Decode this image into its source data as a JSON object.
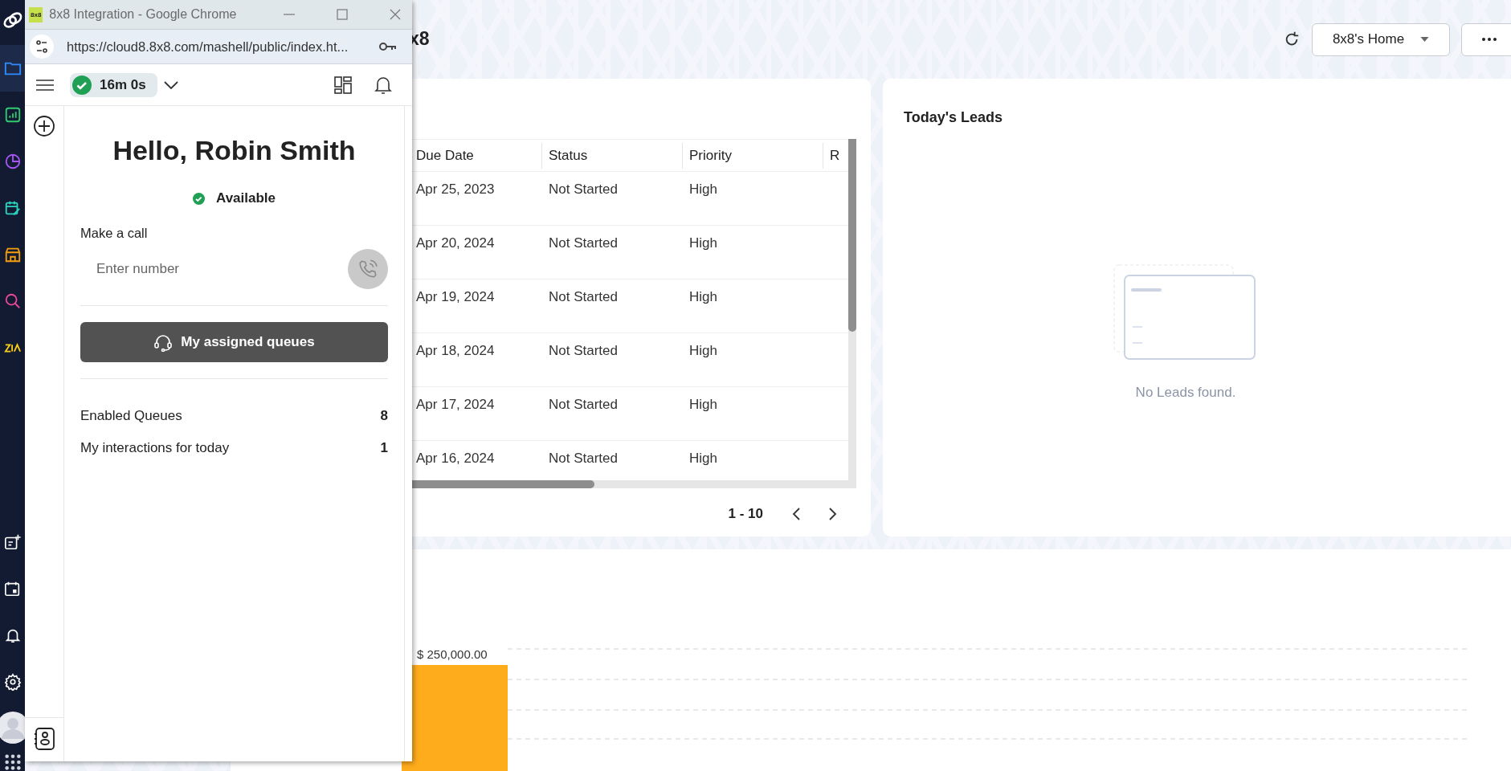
{
  "page": {
    "title": "x8",
    "home_dropdown": "8x8's Home"
  },
  "popup": {
    "favicon_text": "8x8",
    "window_title": "8x8 Integration - Google Chrome",
    "url": "https://cloud8.8x8.com/mashell/public/index.ht...",
    "timer": "16m 0s",
    "greeting": "Hello, Robin Smith",
    "status": "Available",
    "call_label": "Make a call",
    "number_placeholder": "Enter number",
    "queues_button": "My assigned queues",
    "stats": [
      {
        "label": "Enabled Queues",
        "value": "8"
      },
      {
        "label": "My interactions for today",
        "value": "1"
      }
    ]
  },
  "tasks_table": {
    "columns": [
      "Due Date",
      "Status",
      "Priority",
      "R"
    ],
    "rows": [
      [
        "Apr 25, 2023",
        "Not Started",
        "High"
      ],
      [
        "Apr 20, 2024",
        "Not Started",
        "High"
      ],
      [
        "Apr 19, 2024",
        "Not Started",
        "High"
      ],
      [
        "Apr 18, 2024",
        "Not Started",
        "High"
      ],
      [
        "Apr 17, 2024",
        "Not Started",
        "High"
      ],
      [
        "Apr 16, 2024",
        "Not Started",
        "High"
      ]
    ],
    "pagination": "1 - 10"
  },
  "leads": {
    "title": "Today's Leads",
    "empty_message": "No Leads found."
  },
  "chart": {
    "bar_label": "$ 250,000.00"
  }
}
